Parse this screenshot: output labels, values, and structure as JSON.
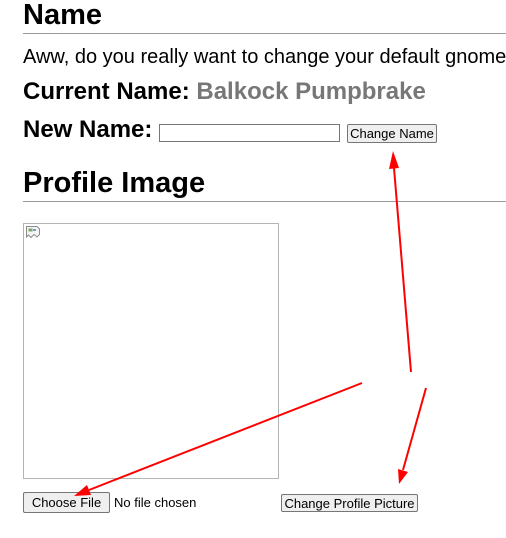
{
  "name_section": {
    "heading": "Name",
    "intro": "Aww, do you really want to change your default gnome",
    "current_label": "Current Name:",
    "current_value": "Balkock Pumpbrake",
    "new_label": "New Name:",
    "new_name_value": "",
    "change_button": "Change Name"
  },
  "profile_section": {
    "heading": "Profile Image",
    "image_icon": "broken-image-icon",
    "choose_file_button": "Choose File",
    "file_status": "No file chosen",
    "change_picture_button": "Change Profile Picture"
  },
  "colors": {
    "annotation_arrow": "#ff0000",
    "muted_name": "#777777"
  }
}
